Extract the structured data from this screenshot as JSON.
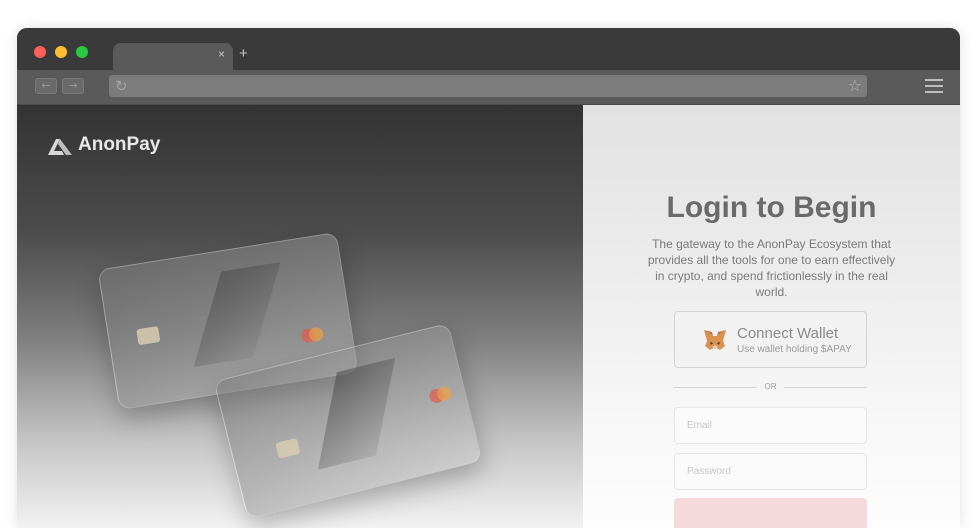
{
  "browser": {
    "tab_close": "×",
    "new_tab": "+",
    "back": "←",
    "forward": "→",
    "reload": "↻",
    "star": "☆"
  },
  "brand": {
    "name": "AnonPay"
  },
  "login": {
    "title": "Login to Begin",
    "description": "The gateway to the AnonPay Ecosystem that provides all the tools for one to earn effectively in crypto, and spend frictionlessly in the real world.",
    "connect_wallet_title": "Connect Wallet",
    "connect_wallet_sub": "Use wallet holding $APAY",
    "or": "OR",
    "email_placeholder": "Email",
    "password_placeholder": "Password",
    "submit_label": ""
  },
  "colors": {
    "accent": "#f6d9dc",
    "text": "#6a6a6a"
  },
  "icons": {
    "logo": "anonpay-logo-icon",
    "wallet": "metamask-fox-icon"
  }
}
